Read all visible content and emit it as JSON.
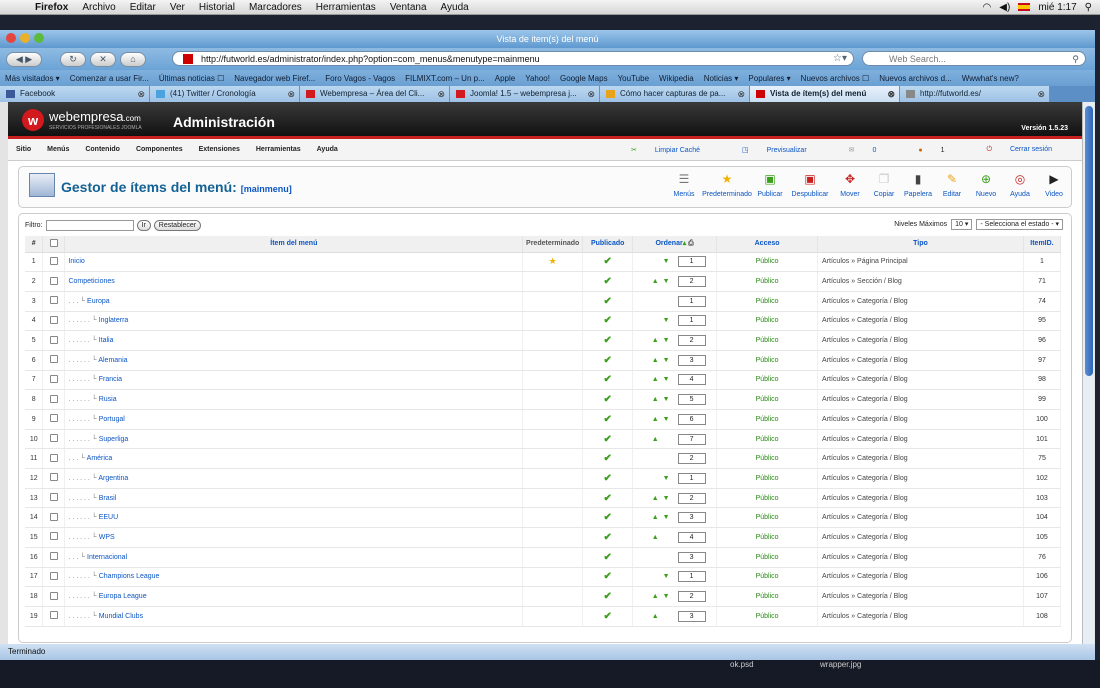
{
  "os_menubar": {
    "app": "Firefox",
    "items": [
      "Archivo",
      "Editar",
      "Ver",
      "Historial",
      "Marcadores",
      "Herramientas",
      "Ventana",
      "Ayuda"
    ],
    "clock": "mié 1:17"
  },
  "window_title": "Vista de item(s) del menú",
  "url": "http://futworld.es/administrator/index.php?option=com_menus&menutype=mainmenu",
  "search_placeholder": "Web Search...",
  "bookmarks": [
    "Más visitados ▾",
    "Comenzar a usar Fir...",
    "Últimas noticias ☐",
    "Navegador web Firef...",
    "Foro Vagos - Vagos",
    "FILMIXT.com – Un p...",
    "Apple",
    "Yahoo!",
    "Google Maps",
    "YouTube",
    "Wikipedia",
    "Noticias ▾",
    "Populares ▾",
    "Nuevos archivos ☐",
    "Nuevos archivos d...",
    "Wwwhat's new?"
  ],
  "tabs": [
    "Facebook",
    "(41) Twitter / Cronología",
    "Webempresa – Área del Cli...",
    "Joomla! 1.5 – webempresa j...",
    "Cómo hacer capturas de pa...",
    "Vista de ítem(s) del menú",
    "http://futworld.es/"
  ],
  "active_tab_index": 5,
  "joomla": {
    "brand": "webempresa",
    "brand_suffix": ".com",
    "brand_tagline": "SERVICIOS PROFESIONALES JOOMLA",
    "header_title": "Administración",
    "version": "Versión 1.5.23",
    "menu": [
      "Sitio",
      "Menús",
      "Contenido",
      "Componentes",
      "Extensiones",
      "Herramientas",
      "Ayuda"
    ],
    "menu_right": [
      "Limpiar Caché",
      "Previsualizar",
      "0",
      "1",
      "Cerrar sesión"
    ],
    "manager_title": "Gestor de ítems del menú:",
    "manager_sub": "[mainmenu]",
    "toolbar": [
      "Menús",
      "Predeterminado",
      "Publicar",
      "Despublicar",
      "Mover",
      "Copiar",
      "Papelera",
      "Editar",
      "Nuevo",
      "Ayuda",
      "Video"
    ],
    "filter_label": "Filtro:",
    "go_label": "Ir",
    "reset_label": "Restablecer",
    "levels_label": "Niveles Máximos",
    "levels_value": "10",
    "state_select": "- Selecciona el estado -",
    "columns": [
      "#",
      "",
      "Ítem del menú",
      "Predeterminado",
      "Publicado",
      "Ordenar",
      "Acceso",
      "Tipo",
      "ItemID."
    ],
    "rows": [
      {
        "n": "1",
        "title": "Inicio",
        "indent": "",
        "default": true,
        "up": false,
        "down": true,
        "order": "1",
        "access": "Público",
        "type": "Artículos » Página Principal",
        "id": "1"
      },
      {
        "n": "2",
        "title": "Competiciones",
        "indent": "",
        "default": false,
        "up": true,
        "down": true,
        "order": "2",
        "access": "Público",
        "type": "Artículos » Sección / Blog",
        "id": "71"
      },
      {
        "n": "3",
        "title": "Europa",
        "indent": ". . . └ ",
        "default": false,
        "up": false,
        "down": false,
        "order": "1",
        "access": "Público",
        "type": "Artículos » Categoría / Blog",
        "id": "74"
      },
      {
        "n": "4",
        "title": "Inglaterra",
        "indent": ". . . . . . └ ",
        "default": false,
        "up": false,
        "down": true,
        "order": "1",
        "access": "Público",
        "type": "Artículos » Categoría / Blog",
        "id": "95"
      },
      {
        "n": "5",
        "title": "Italia",
        "indent": ". . . . . . └ ",
        "default": false,
        "up": true,
        "down": true,
        "order": "2",
        "access": "Público",
        "type": "Artículos » Categoría / Blog",
        "id": "96"
      },
      {
        "n": "6",
        "title": "Alemania",
        "indent": ". . . . . . └ ",
        "default": false,
        "up": true,
        "down": true,
        "order": "3",
        "access": "Público",
        "type": "Artículos » Categoría / Blog",
        "id": "97"
      },
      {
        "n": "7",
        "title": "Francia",
        "indent": ". . . . . . └ ",
        "default": false,
        "up": true,
        "down": true,
        "order": "4",
        "access": "Público",
        "type": "Artículos » Categoría / Blog",
        "id": "98"
      },
      {
        "n": "8",
        "title": "Rusia",
        "indent": ". . . . . . └ ",
        "default": false,
        "up": true,
        "down": true,
        "order": "5",
        "access": "Público",
        "type": "Artículos » Categoría / Blog",
        "id": "99"
      },
      {
        "n": "9",
        "title": "Portugal",
        "indent": ". . . . . . └ ",
        "default": false,
        "up": true,
        "down": true,
        "order": "6",
        "access": "Público",
        "type": "Artículos » Categoría / Blog",
        "id": "100"
      },
      {
        "n": "10",
        "title": "Superliga",
        "indent": ". . . . . . └ ",
        "default": false,
        "up": true,
        "down": false,
        "order": "7",
        "access": "Público",
        "type": "Artículos » Categoría / Blog",
        "id": "101"
      },
      {
        "n": "11",
        "title": "América",
        "indent": ". . . └ ",
        "default": false,
        "up": false,
        "down": false,
        "order": "2",
        "access": "Público",
        "type": "Artículos » Categoría / Blog",
        "id": "75"
      },
      {
        "n": "12",
        "title": "Argentina",
        "indent": ". . . . . . └ ",
        "default": false,
        "up": false,
        "down": true,
        "order": "1",
        "access": "Público",
        "type": "Artículos » Categoría / Blog",
        "id": "102"
      },
      {
        "n": "13",
        "title": "Brasil",
        "indent": ". . . . . . └ ",
        "default": false,
        "up": true,
        "down": true,
        "order": "2",
        "access": "Público",
        "type": "Artículos » Categoría / Blog",
        "id": "103"
      },
      {
        "n": "14",
        "title": "EEUU",
        "indent": ". . . . . . └ ",
        "default": false,
        "up": true,
        "down": true,
        "order": "3",
        "access": "Público",
        "type": "Artículos » Categoría / Blog",
        "id": "104"
      },
      {
        "n": "15",
        "title": "WPS",
        "indent": ". . . . . . └ ",
        "default": false,
        "up": true,
        "down": false,
        "order": "4",
        "access": "Público",
        "type": "Artículos » Categoría / Blog",
        "id": "105"
      },
      {
        "n": "16",
        "title": "Internacional",
        "indent": ". . . └ ",
        "default": false,
        "up": false,
        "down": false,
        "order": "3",
        "access": "Público",
        "type": "Artículos » Categoría / Blog",
        "id": "76"
      },
      {
        "n": "17",
        "title": "Champions League",
        "indent": ". . . . . . └ ",
        "default": false,
        "up": false,
        "down": true,
        "order": "1",
        "access": "Público",
        "type": "Artículos » Categoría / Blog",
        "id": "106"
      },
      {
        "n": "18",
        "title": "Europa League",
        "indent": ". . . . . . └ ",
        "default": false,
        "up": true,
        "down": true,
        "order": "2",
        "access": "Público",
        "type": "Artículos » Categoría / Blog",
        "id": "107"
      },
      {
        "n": "19",
        "title": "Mundial Clubs",
        "indent": ". . . . . . └ ",
        "default": false,
        "up": true,
        "down": false,
        "order": "3",
        "access": "Público",
        "type": "Artículos » Categoría / Blog",
        "id": "108"
      }
    ]
  },
  "status": "Terminado",
  "desktop_files": [
    "ok.psd",
    "wrapper.jpg"
  ],
  "colors": {
    "link": "#0b55c4",
    "green": "#3aa01b",
    "red": "#c92020"
  }
}
